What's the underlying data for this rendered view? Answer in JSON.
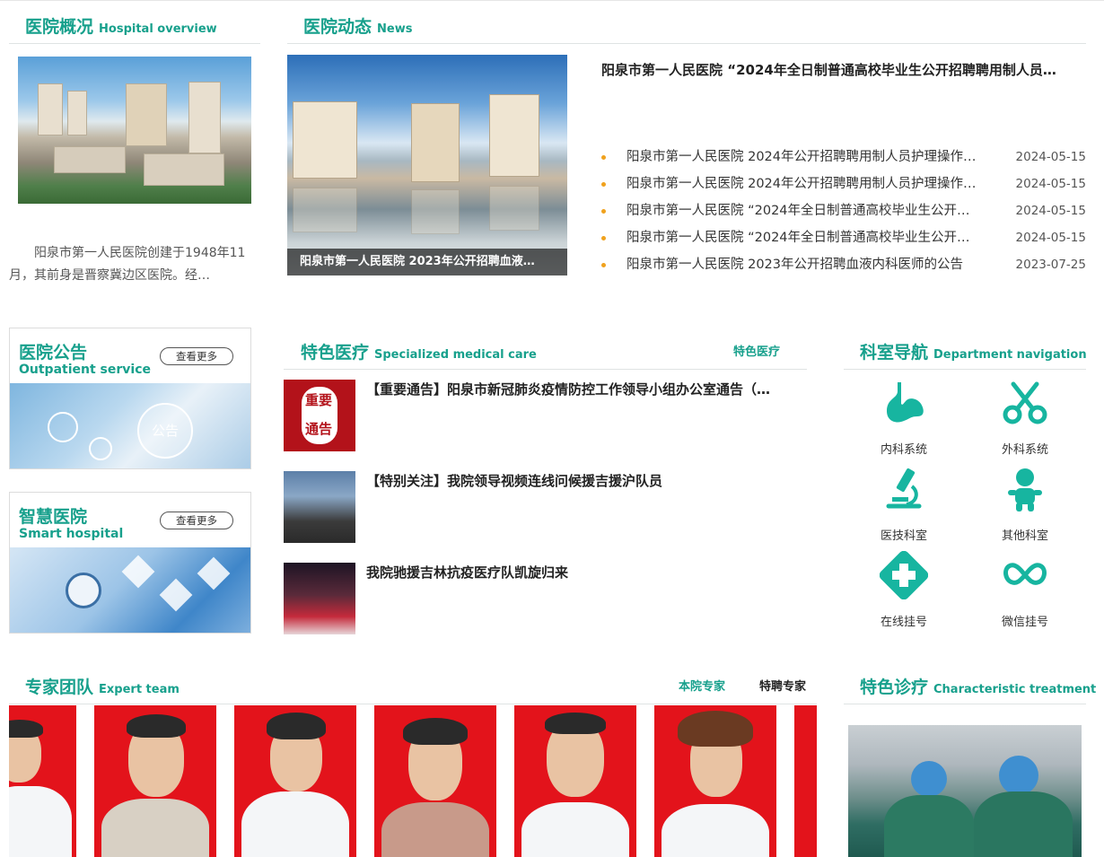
{
  "overview": {
    "title_cn": "医院概况",
    "title_en": "Hospital overview",
    "text": "阳泉市第一人民医院创建于1948年11月，其前身是晋察冀边区医院。经…"
  },
  "news": {
    "title_cn": "医院动态",
    "title_en": "News",
    "image_caption": "阳泉市第一人民医院 2023年公开招聘血液…",
    "headline": "阳泉市第一人民医院 “2024年全日制普通高校毕业生公开招聘聘用制人员…",
    "items": [
      {
        "title": "阳泉市第一人民医院 2024年公开招聘聘用制人员护理操作…",
        "date": "2024-05-15"
      },
      {
        "title": "阳泉市第一人民医院 2024年公开招聘聘用制人员护理操作…",
        "date": "2024-05-15"
      },
      {
        "title": "阳泉市第一人民医院 “2024年全日制普通高校毕业生公开…",
        "date": "2024-05-15"
      },
      {
        "title": "阳泉市第一人民医院 “2024年全日制普通高校毕业生公开…",
        "date": "2024-05-15"
      },
      {
        "title": "阳泉市第一人民医院 2023年公开招聘血液内科医师的公告",
        "date": "2023-07-25"
      }
    ]
  },
  "notice_card": {
    "title_cn": "医院公告",
    "title_en": "Outpatient service",
    "more": "查看更多",
    "img_label": "公告"
  },
  "smart_card": {
    "title_cn": "智慧医院",
    "title_en": "Smart hospital",
    "more": "查看更多"
  },
  "featured": {
    "title_cn": "特色医疗",
    "title_en": "Specialized medical care",
    "tab": "特色医疗",
    "thumb_text_1": "重要",
    "thumb_text_2": "通告",
    "items": [
      {
        "title": "【重要通告】阳泉市新冠肺炎疫情防控工作领导小组办公室通告（…"
      },
      {
        "title": "【特别关注】我院领导视频连线问候援吉援沪队员"
      },
      {
        "title": "我院驰援吉林抗疫医疗队凯旋归来"
      }
    ]
  },
  "dept_nav": {
    "title_cn": "科室导航",
    "title_en": "Department navigation",
    "items": [
      {
        "label": "内科系统",
        "icon": "stomach-icon"
      },
      {
        "label": "外科系统",
        "icon": "scissors-icon"
      },
      {
        "label": "医技科室",
        "icon": "microscope-icon"
      },
      {
        "label": "其他科室",
        "icon": "baby-icon"
      },
      {
        "label": "在线挂号",
        "icon": "medical-cross-icon"
      },
      {
        "label": "微信挂号",
        "icon": "wechat-icon"
      }
    ]
  },
  "experts": {
    "title_cn": "专家团队",
    "title_en": "Expert team",
    "tab_in_house": "本院专家",
    "tab_hired": "特聘专家"
  },
  "treatment": {
    "title_cn": "特色诊疗",
    "title_en": "Characteristic treatment"
  },
  "colors": {
    "accent": "#17a08c",
    "bullet": "#f0a21e",
    "expert_bg": "#e3131b"
  }
}
